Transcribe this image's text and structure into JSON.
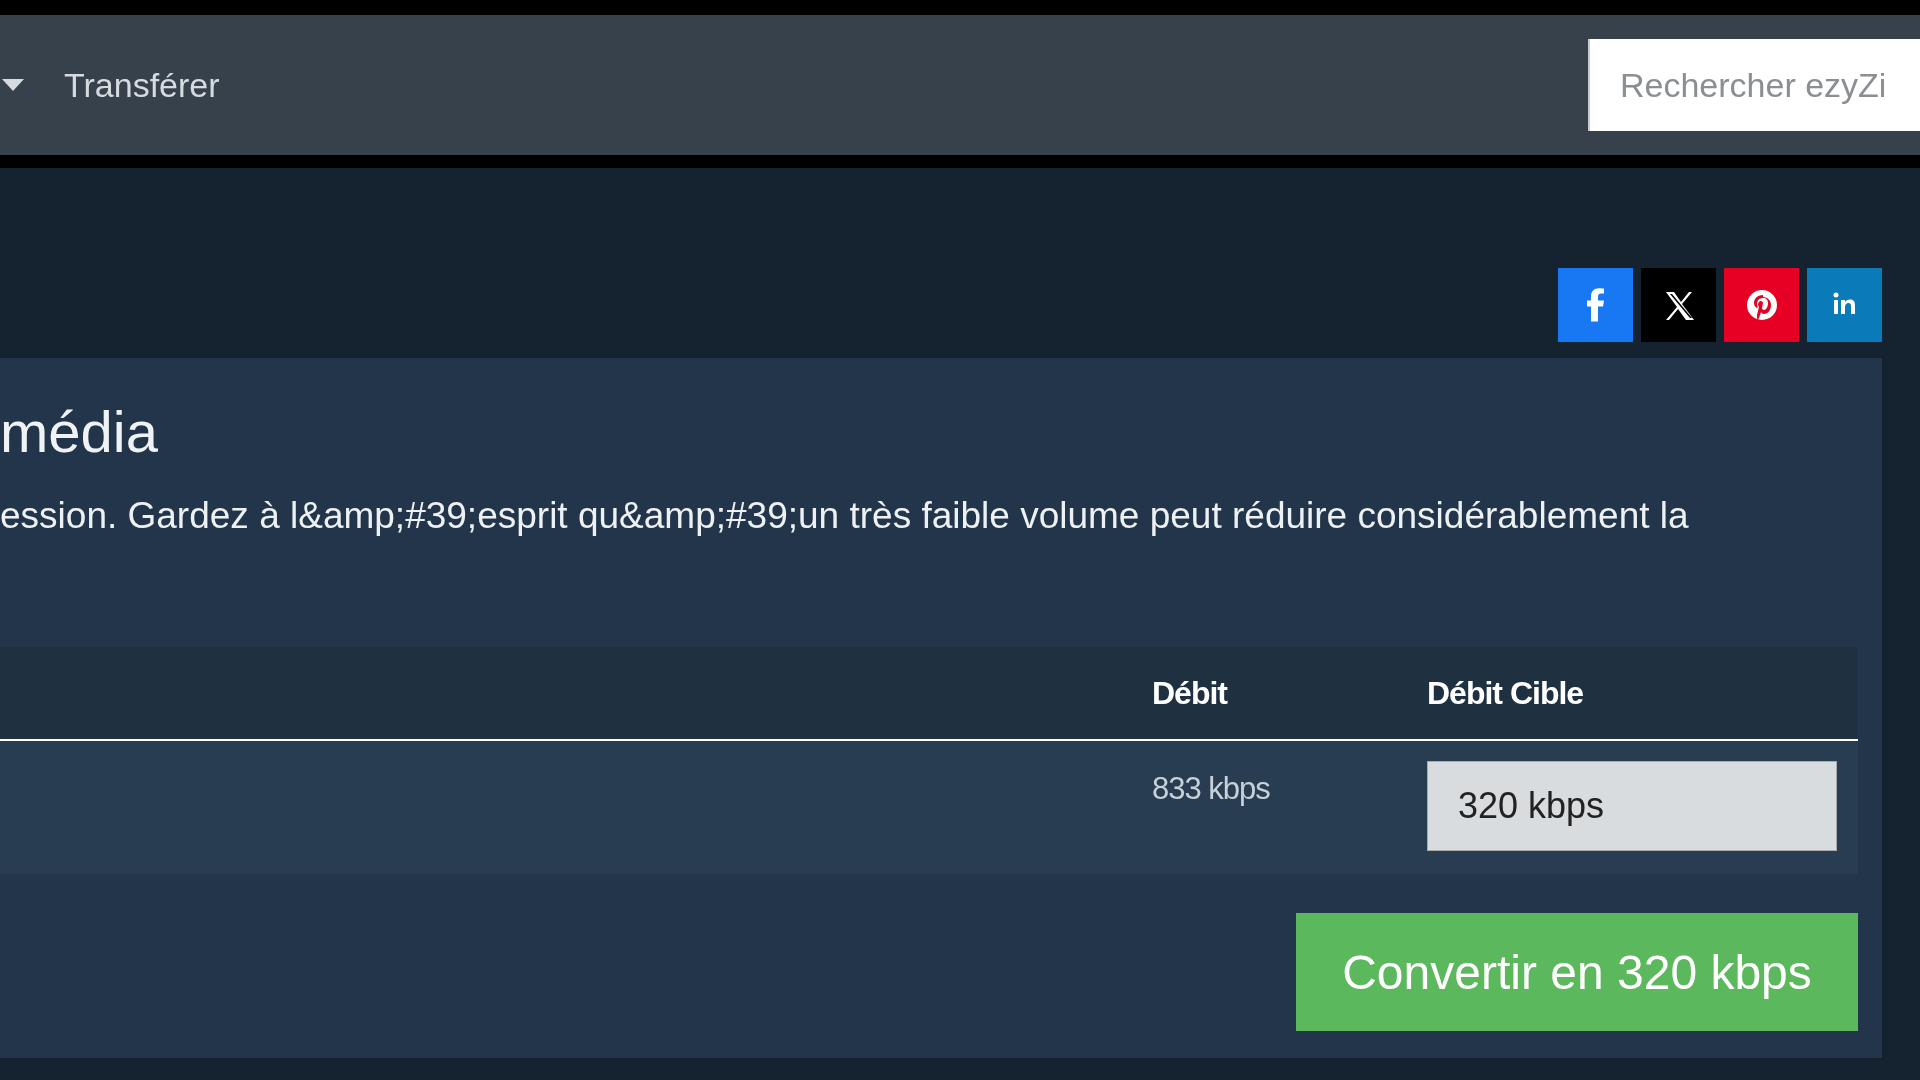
{
  "nav": {
    "items": [
      {
        "label": "Transférer"
      }
    ],
    "search": {
      "placeholder": "Rechercher ezyZi"
    }
  },
  "share": [
    {
      "kind": "facebook"
    },
    {
      "kind": "x"
    },
    {
      "kind": "pinterest"
    },
    {
      "kind": "linkedin"
    }
  ],
  "panel": {
    "heading": "média",
    "text": "ession. Gardez à l&amp;#39;esprit qu&amp;#39;un très faible volume peut réduire considérablement la",
    "table": {
      "columns": [
        "Débit",
        "Débit Cible"
      ],
      "rows": [
        {
          "bitrate": "833 kbps",
          "target": "320 kbps"
        }
      ]
    },
    "button": "Convertir en 320 kbps"
  }
}
